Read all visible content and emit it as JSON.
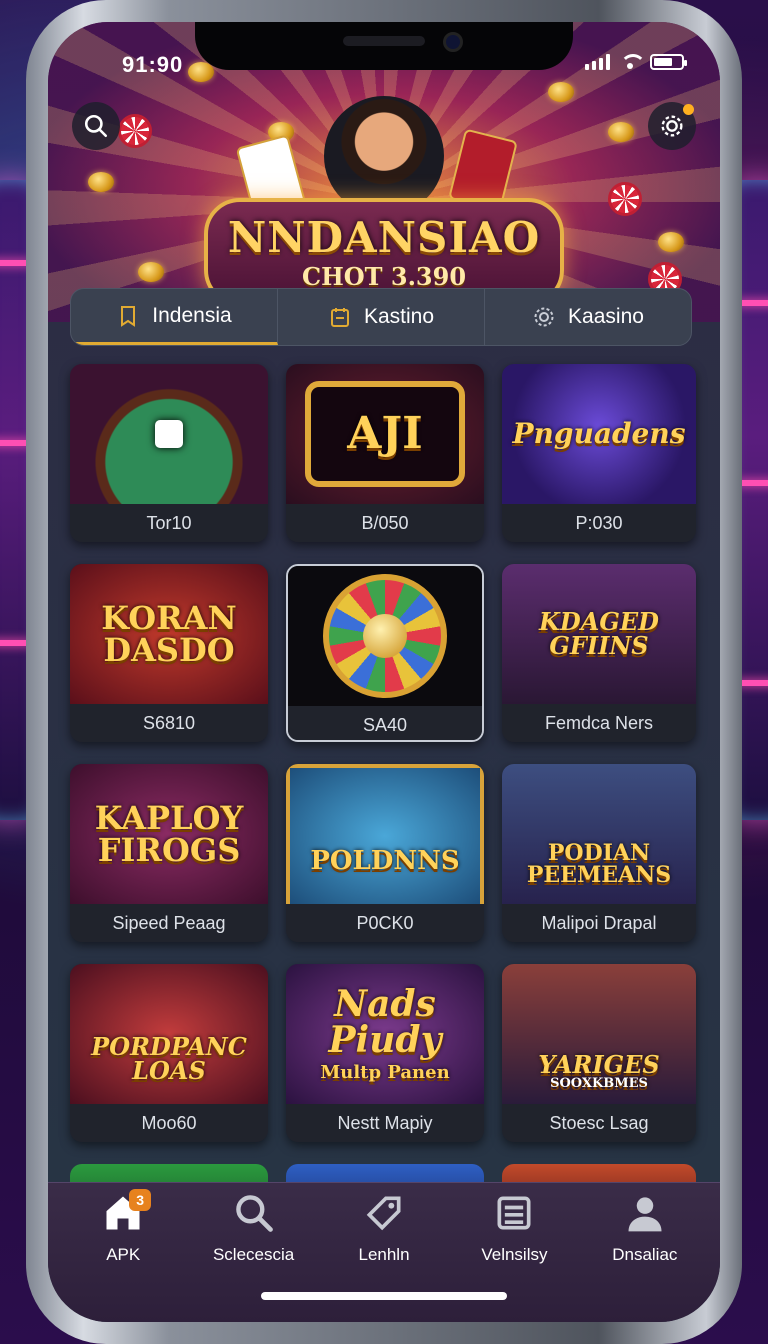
{
  "status_bar": {
    "time": "91:90"
  },
  "hero": {
    "logo_title": "NNDANSIAO",
    "logo_subtitle": "CHOT 3.390"
  },
  "tabs": [
    {
      "label": "Indensia",
      "icon": "bookmark-icon",
      "active": true
    },
    {
      "label": "Kastino",
      "icon": "calendar-icon",
      "active": false
    },
    {
      "label": "Kaasino",
      "icon": "gear-icon",
      "active": false
    }
  ],
  "games": [
    {
      "caption": "Tor10",
      "art_title": "",
      "theme": "roulette-table"
    },
    {
      "caption": "B/050",
      "art_title": "AJI",
      "theme": "slot-machine"
    },
    {
      "caption": "P:030",
      "art_title": "Pnguadens",
      "theme": "star-wheel"
    },
    {
      "caption": "S6810",
      "art_title": "KORAN DASDO",
      "theme": "coins"
    },
    {
      "caption": "SA40",
      "art_title": "",
      "theme": "prize-wheel",
      "selected": true
    },
    {
      "caption": "Femdca Ners",
      "art_title": "KDAGED GFIINS",
      "theme": "people"
    },
    {
      "caption": "Sipeed Peaag",
      "art_title": "KAPLOY FIROGS",
      "theme": "coins"
    },
    {
      "caption": "P0CK0",
      "art_title": "POLDNNS",
      "theme": "cowboy"
    },
    {
      "caption": "Malipoi Drapal",
      "art_title": "PODIAN PEEMEANS",
      "theme": "people"
    },
    {
      "caption": "Moo60",
      "art_title": "PORDPANC LOAS",
      "theme": "people"
    },
    {
      "caption": "Nestt Mapiy",
      "art_title": "Nads Piudy",
      "art_subtitle": "Multp Panen",
      "theme": "party"
    },
    {
      "caption": "Stoesc Lsag",
      "art_title": "YARIGES",
      "art_subtitle": "SOOXKBMES",
      "theme": "people"
    }
  ],
  "nav": [
    {
      "label": "APK",
      "icon": "home-icon",
      "badge": "3"
    },
    {
      "label": "Sclecescia",
      "icon": "search-icon"
    },
    {
      "label": "Lenhln",
      "icon": "tag-icon"
    },
    {
      "label": "Velnsilsy",
      "icon": "list-icon"
    },
    {
      "label": "Dnsaliac",
      "icon": "user-icon"
    }
  ],
  "colors": {
    "accent": "#e1aa32",
    "badge": "#e7821e"
  }
}
